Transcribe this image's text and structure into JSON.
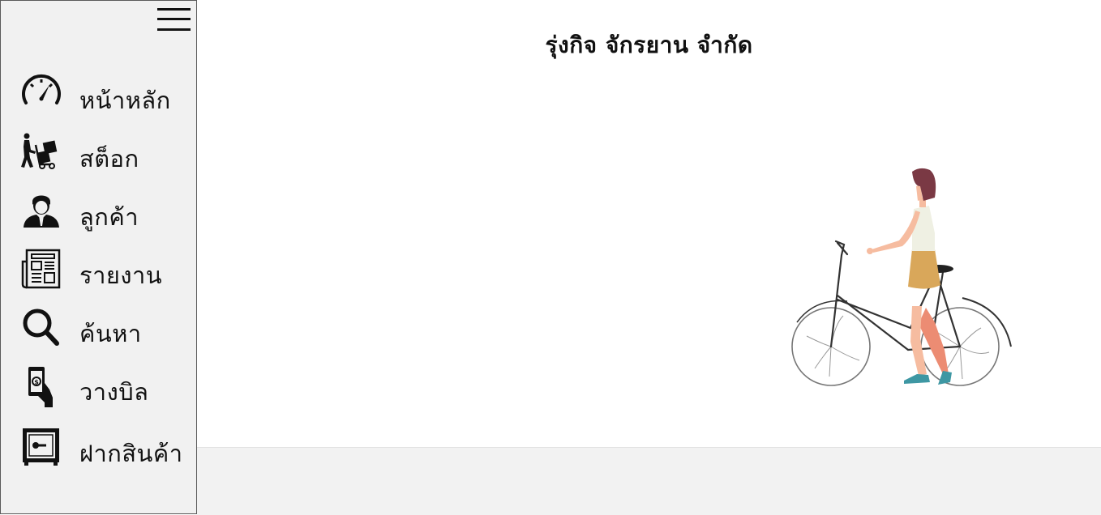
{
  "header": {
    "title": "รุ่งกิจ จักรยาน จำกัด"
  },
  "sidebar": {
    "items": [
      {
        "label": "หน้าหลัก",
        "icon": "speedometer-icon"
      },
      {
        "label": "สต็อก",
        "icon": "hand-truck-icon"
      },
      {
        "label": "ลูกค้า",
        "icon": "customer-icon"
      },
      {
        "label": "รายงาน",
        "icon": "newspaper-icon"
      },
      {
        "label": "ค้นหา",
        "icon": "search-icon"
      },
      {
        "label": "วางบิล",
        "icon": "hand-money-icon"
      },
      {
        "label": "ฝากสินค้า",
        "icon": "safe-box-icon"
      }
    ]
  }
}
